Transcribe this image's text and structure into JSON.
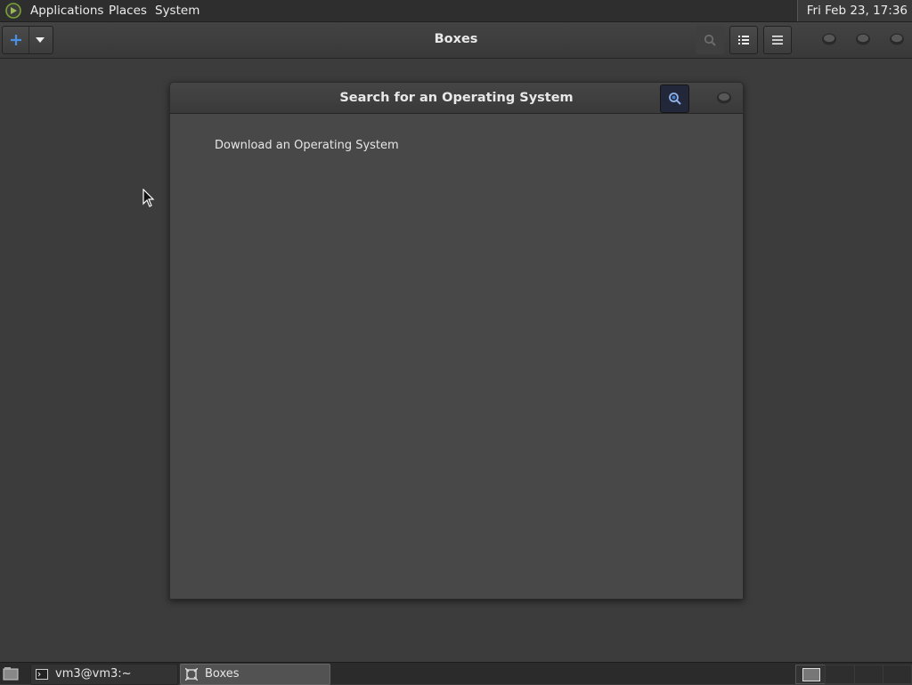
{
  "top_panel": {
    "menus": [
      "Applications",
      "Places",
      "System"
    ],
    "clock": "Fri Feb 23, 17:36"
  },
  "headerbar": {
    "title": "Boxes",
    "icons": {
      "new": "plus-icon",
      "new_dropdown": "chevron-down-icon",
      "search": "search-icon",
      "selection": "list-view-icon",
      "menu": "hamburger-menu-icon",
      "window_controls": [
        "minimize-icon",
        "maximize-icon",
        "close-icon"
      ]
    }
  },
  "dialog": {
    "title": "Search for an Operating System",
    "items": [
      "Download an Operating System"
    ]
  },
  "taskbar": {
    "tasks": [
      {
        "label": "vm3@vm3:~",
        "active": false
      },
      {
        "label": "Boxes",
        "active": true
      }
    ]
  },
  "colors": {
    "background": "#3c3c3c",
    "accent_blue": "#4a90e2",
    "search_active": "#22273a"
  }
}
